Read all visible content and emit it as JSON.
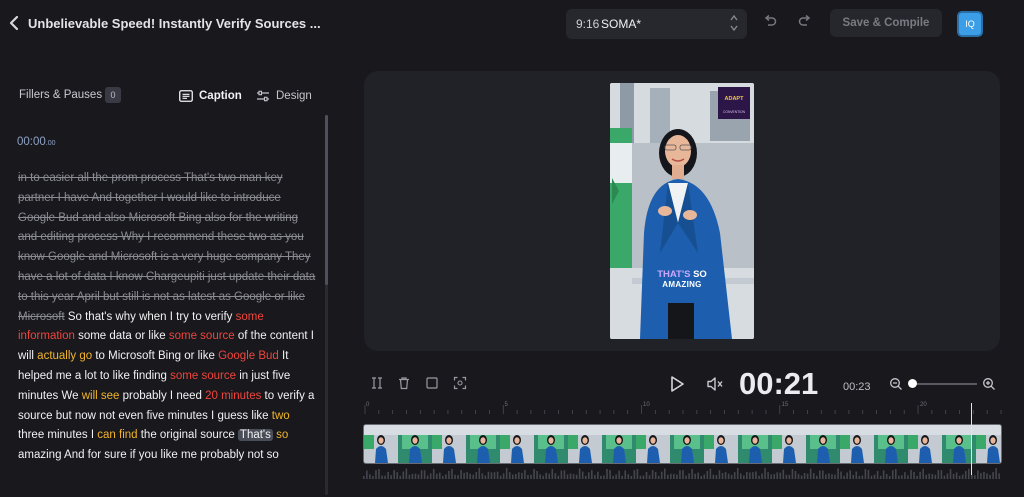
{
  "header": {
    "back_icon": "chevron-left-icon",
    "title": "Unbelievable Speed! Instantly Verify Sources ...",
    "aspect_ratio": "9:16",
    "template_name": "SOMA*",
    "undo_icon": "undo-icon",
    "redo_icon": "redo-icon",
    "save_label": "Save & Compile",
    "avatar_initials": "IQ"
  },
  "left_panel": {
    "fillers_label": "Fillers & Pauses",
    "fillers_count": "0",
    "tab_caption": "Caption",
    "tab_design": "Design",
    "timecode_main": "00:00",
    "timecode_frac": ".00"
  },
  "transcript": [
    {
      "t": "in to easier all the prom process That's two man key partner I have And together I would like to introduce Google Bud and also Microsoft Bing also for the writing and editing process Why I recommend these two as you know Google and Microsoft is a very huge company They have a lot of data I know Chargeupiti just update their data to this year April but still is not as latest as Google or like Microsoft",
      "s": "struck"
    },
    {
      "t": " So that's why when I try to verify ",
      "s": ""
    },
    {
      "t": "some information",
      "s": "red"
    },
    {
      "t": " some data or like ",
      "s": ""
    },
    {
      "t": "some source",
      "s": "red"
    },
    {
      "t": " of the content I will ",
      "s": ""
    },
    {
      "t": "actually go",
      "s": "yellow"
    },
    {
      "t": " to Microsoft Bing or like ",
      "s": ""
    },
    {
      "t": "Google Bud",
      "s": "red"
    },
    {
      "t": " It helped me a lot to like finding ",
      "s": ""
    },
    {
      "t": "some source",
      "s": "red"
    },
    {
      "t": " in just five minutes We ",
      "s": ""
    },
    {
      "t": "will see",
      "s": "yellow"
    },
    {
      "t": " probably I need ",
      "s": ""
    },
    {
      "t": "20 minutes",
      "s": "red"
    },
    {
      "t": " to verify a source but now not even five minutes I guess like ",
      "s": ""
    },
    {
      "t": "two",
      "s": "yellow"
    },
    {
      "t": " three minutes I ",
      "s": ""
    },
    {
      "t": "can find",
      "s": "yellow"
    },
    {
      "t": " the original source ",
      "s": ""
    },
    {
      "t": "That's",
      "s": "hl"
    },
    {
      "t": " ",
      "s": ""
    },
    {
      "t": "so",
      "s": "yellow"
    },
    {
      "t": " amazing And for sure if you like me probably not so",
      "s": ""
    }
  ],
  "preview": {
    "caption_line1_a": "THAT'S",
    "caption_line1_b": "SO",
    "caption_line2": "AMAZING",
    "logo_text_1": "ADAPT",
    "logo_text_2": "CONVENTION"
  },
  "player": {
    "current_time": "00:21",
    "total_time": "00:23",
    "zoom_level": 0.05
  },
  "timeline": {
    "ruler_marks": [
      "0",
      "5",
      "10",
      "15",
      "20"
    ]
  },
  "colors": {
    "background": "#18181d",
    "accent_red": "#f0453c",
    "accent_yellow": "#f2b52b",
    "accent_blue": "#3b9ee6"
  }
}
